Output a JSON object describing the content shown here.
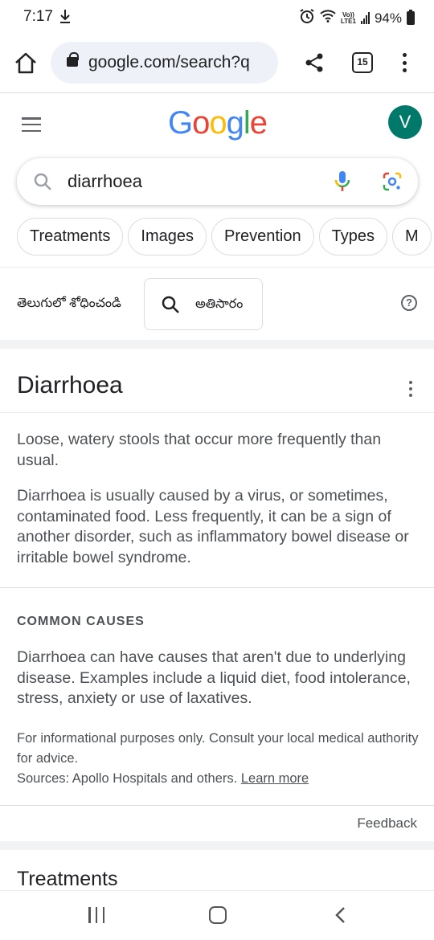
{
  "status": {
    "time": "7:17",
    "download_icon": "download-icon",
    "net_label_top": "Vo))",
    "net_label_bottom": "LTE1",
    "battery": "94%"
  },
  "browser": {
    "url": "google.com/search?q",
    "tab_count": "15"
  },
  "google": {
    "logo_letters": [
      {
        "ch": "G",
        "color": "#4285F4"
      },
      {
        "ch": "o",
        "color": "#EA4335"
      },
      {
        "ch": "o",
        "color": "#FBBC05"
      },
      {
        "ch": "g",
        "color": "#4285F4"
      },
      {
        "ch": "l",
        "color": "#34A853"
      },
      {
        "ch": "e",
        "color": "#EA4335"
      }
    ],
    "avatar_initial": "V",
    "avatar_color": "#00796b"
  },
  "search": {
    "query": "diarrhoea"
  },
  "chips": [
    "Treatments",
    "Images",
    "Prevention",
    "Types",
    "M"
  ],
  "telugu": {
    "label": "తెలుగులో శోధించండి",
    "button": "అతిసారం"
  },
  "card": {
    "title": "Diarrhoea",
    "summary": "Loose, watery stools that occur more frequently than usual.",
    "detail": "Diarrhoea is usually caused by a virus, or sometimes, contaminated food. Less frequently, it can be a sign of another disorder, such as inflammatory bowel disease or irritable bowel syndrome.",
    "causes_heading": "COMMON CAUSES",
    "causes_text": "Diarrhoea can have causes that aren't due to underlying disease. Examples include a liquid diet, food intolerance, stress, anxiety or use of laxatives.",
    "disclaimer": "For informational purposes only. Consult your local medical authority for advice.",
    "sources": "Sources: Apollo Hospitals and others.",
    "learn_more": "Learn more",
    "feedback": "Feedback"
  },
  "next_section": "Treatments"
}
